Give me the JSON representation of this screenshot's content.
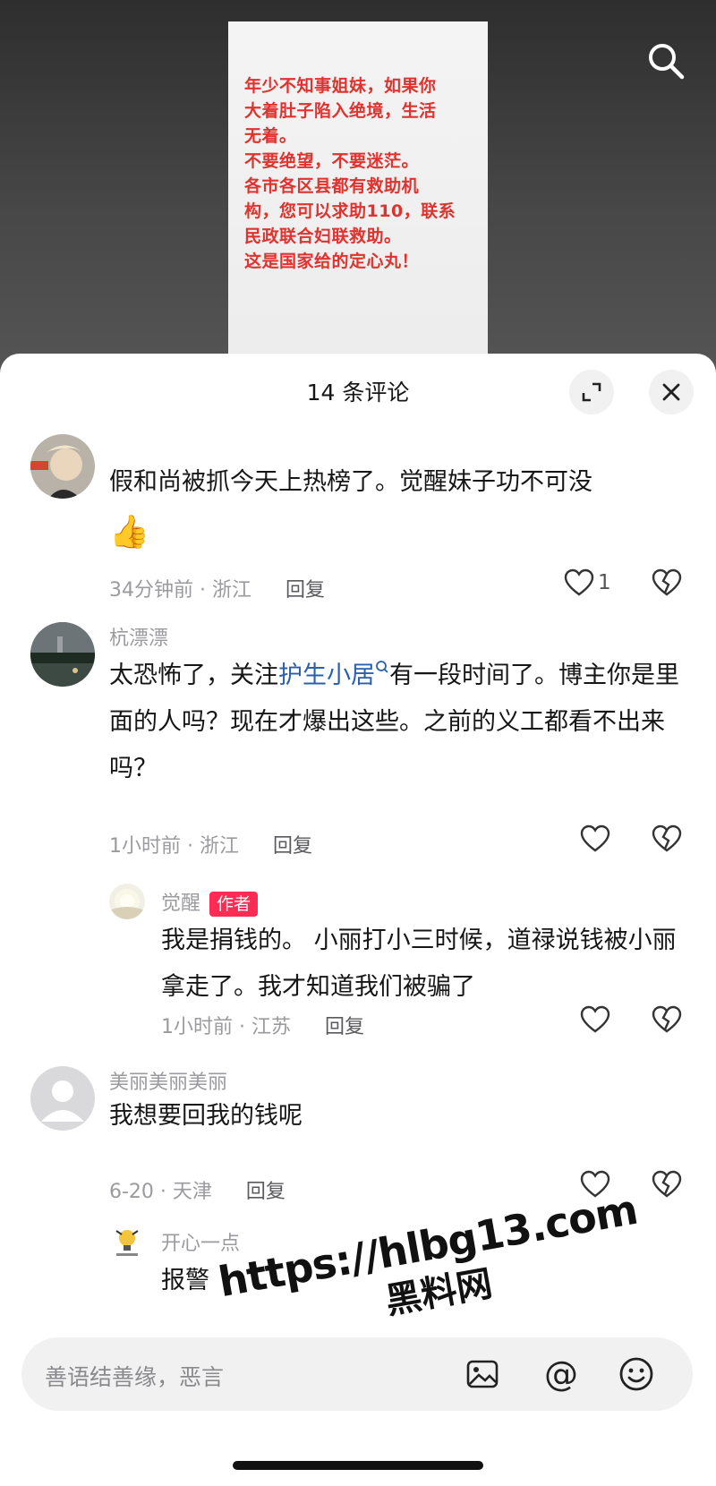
{
  "video": {
    "overlay_text": "年少不知事姐妹，如果你\n大着肚子陷入绝境，生活\n无着。\n不要绝望，不要迷茫。\n各市各区县都有救助机\n构，您可以求助110，联系\n民政联合妇联救助。\n这是国家给的定心丸！",
    "search_icon": "search-icon"
  },
  "sheet": {
    "title": "14 条评论",
    "expand_icon": "expand-icon",
    "close_icon": "close-icon"
  },
  "comments": [
    {
      "username": "",
      "text": "假和尚被抓今天上热榜了。觉醒妹子功不可没",
      "emoji": "👍",
      "time_location": "34分钟前 · 浙江",
      "reply_label": "回复",
      "likes": "1"
    },
    {
      "username": "杭漂漂",
      "text_before": "太恐怖了，关注",
      "mention": "护生小居",
      "mention_icon": "search-icon",
      "text_after": "有一段时间了。博主你是里面的人吗？现在才爆出这些。之前的义工都看不出来吗？",
      "time_location": "1小时前 · 浙江",
      "reply_label": "回复"
    },
    {
      "username": "觉醒",
      "badge": "作者",
      "text": "我是捐钱的。 小丽打小三时候，道禄说钱被小丽拿走了。我才知道我们被骗了",
      "time_location": "1小时前 · 江苏",
      "reply_label": "回复"
    },
    {
      "username": "美丽美丽美丽",
      "text": "我想要回我的钱呢",
      "time_location": "6-20 · 天津",
      "reply_label": "回复"
    },
    {
      "username": "开心一点",
      "text": "报警"
    }
  ],
  "input": {
    "placeholder": "善语结善缘，恶言",
    "image_icon": "image-icon",
    "at_icon": "at-icon",
    "at_glyph": "@",
    "emoji_icon": "emoji-icon"
  },
  "watermark": {
    "url": "https://hlbg13.com",
    "name": "黑料网"
  },
  "colors": {
    "accent": "#fe2c55",
    "mention": "#2a5fb0",
    "video_text": "#e0322f"
  }
}
